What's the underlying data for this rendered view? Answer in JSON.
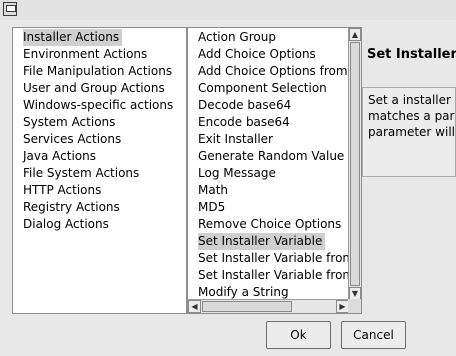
{
  "left_list": {
    "items": [
      "Installer Actions",
      "Environment Actions",
      "File Manipulation Actions",
      "User and Group Actions",
      "Windows-specific actions",
      "System Actions",
      "Services Actions",
      "Java Actions",
      "File System Actions",
      "HTTP Actions",
      "Registry Actions",
      "Dialog Actions"
    ],
    "selected": "Installer Actions"
  },
  "mid_list": {
    "items": [
      "Action Group",
      "Add Choice Options",
      "Add Choice Options from Te",
      "Component Selection",
      "Decode base64",
      "Encode base64",
      "Exit Installer",
      "Generate Random Value",
      "Log Message",
      "Math",
      "MD5",
      "Remove Choice Options",
      "Set Installer Variable",
      "Set Installer Variable from F",
      "Set Installer Variable from F",
      "Modify a String"
    ],
    "selected": "Set Installer Variable"
  },
  "detail": {
    "title": "Set Installer V",
    "description_lines": [
      "Set a installer va",
      "matches a paran",
      "parameter will be"
    ]
  },
  "buttons": {
    "ok": "Ok",
    "cancel": "Cancel"
  },
  "colors": {
    "selection": "#cfcfcf",
    "background": "#e8e8e8"
  }
}
